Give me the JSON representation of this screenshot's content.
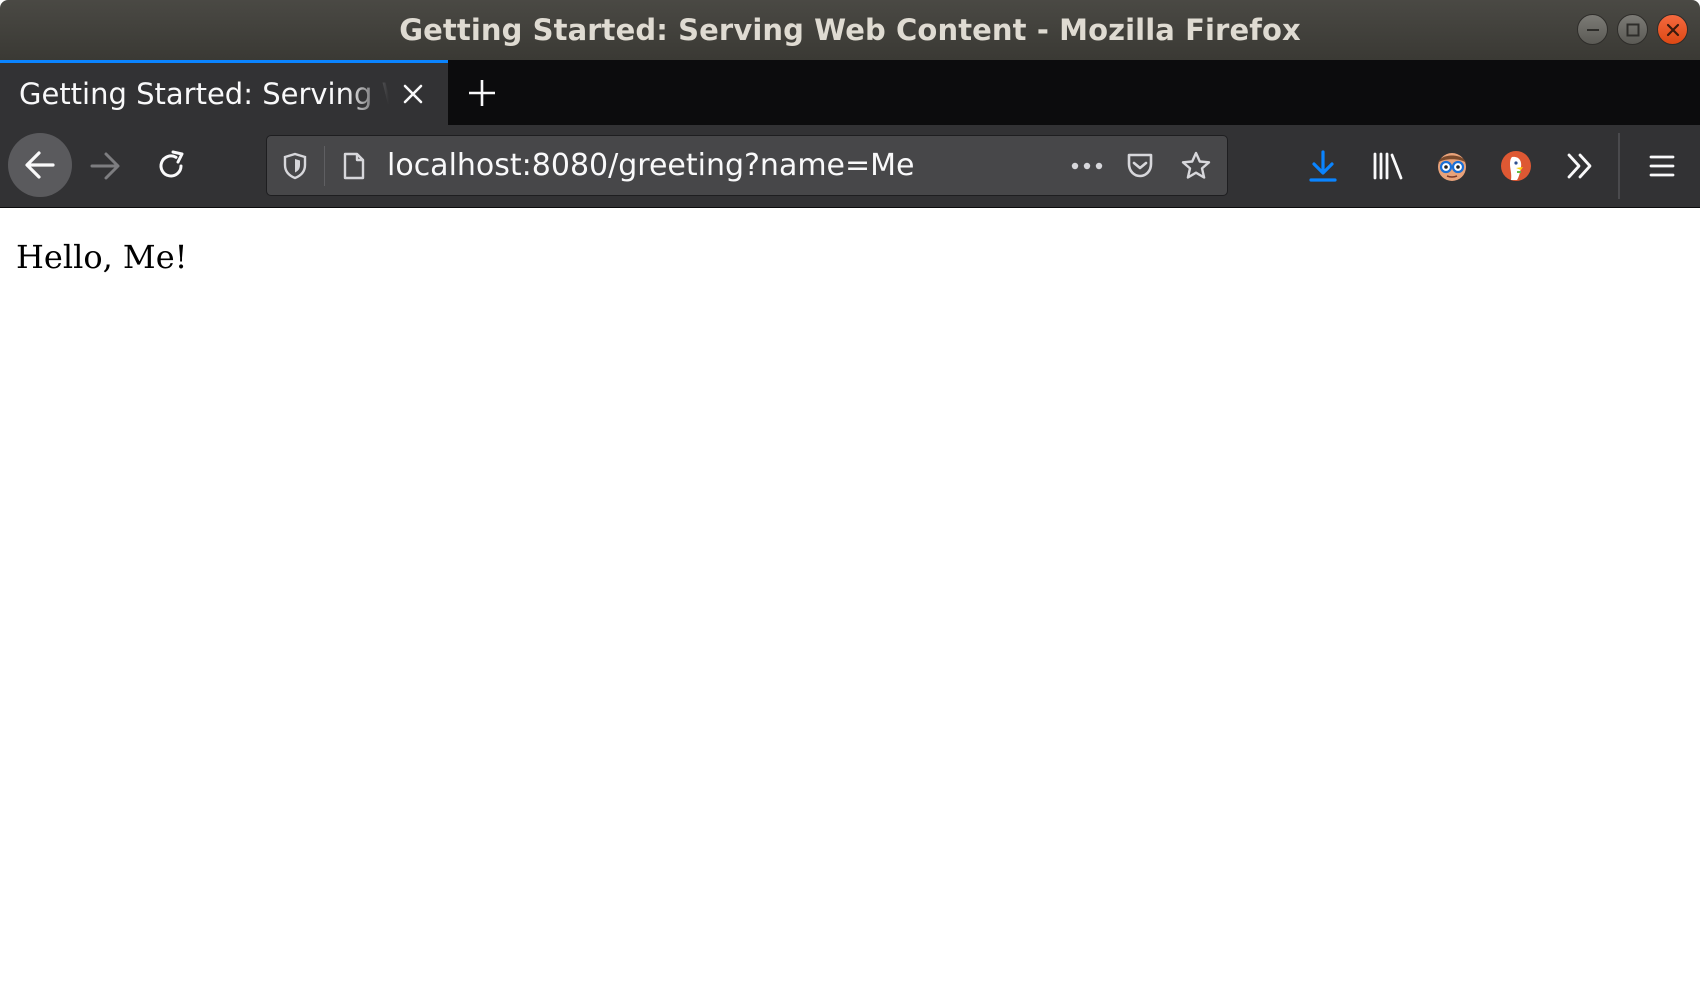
{
  "window": {
    "title": "Getting Started: Serving Web Content - Mozilla Firefox",
    "controls": {
      "minimize_icon": "minimize-icon",
      "maximize_icon": "maximize-icon",
      "close_icon": "close-icon",
      "close_color": "#e95420"
    }
  },
  "tabs": [
    {
      "label": "Getting Started: Serving Web Content",
      "active": true,
      "close_icon": "close-icon"
    }
  ],
  "new_tab_icon": "plus-icon",
  "navbar": {
    "back_icon": "arrow-left-icon",
    "forward_icon": "arrow-right-icon",
    "reload_icon": "reload-icon",
    "url": "localhost:8080/greeting?name=Me",
    "url_icons": [
      "shield-icon",
      "page-icon",
      "more-dots-icon",
      "pocket-icon",
      "star-icon"
    ],
    "toolbar_icons": [
      "download-icon",
      "library-icon",
      "extension-nerd-icon",
      "duckduckgo-icon",
      "chevron-double-right-icon",
      "hamburger-menu-icon"
    ],
    "download_color": "#0a84ff"
  },
  "page": {
    "greeting": "Hello, Me!"
  }
}
